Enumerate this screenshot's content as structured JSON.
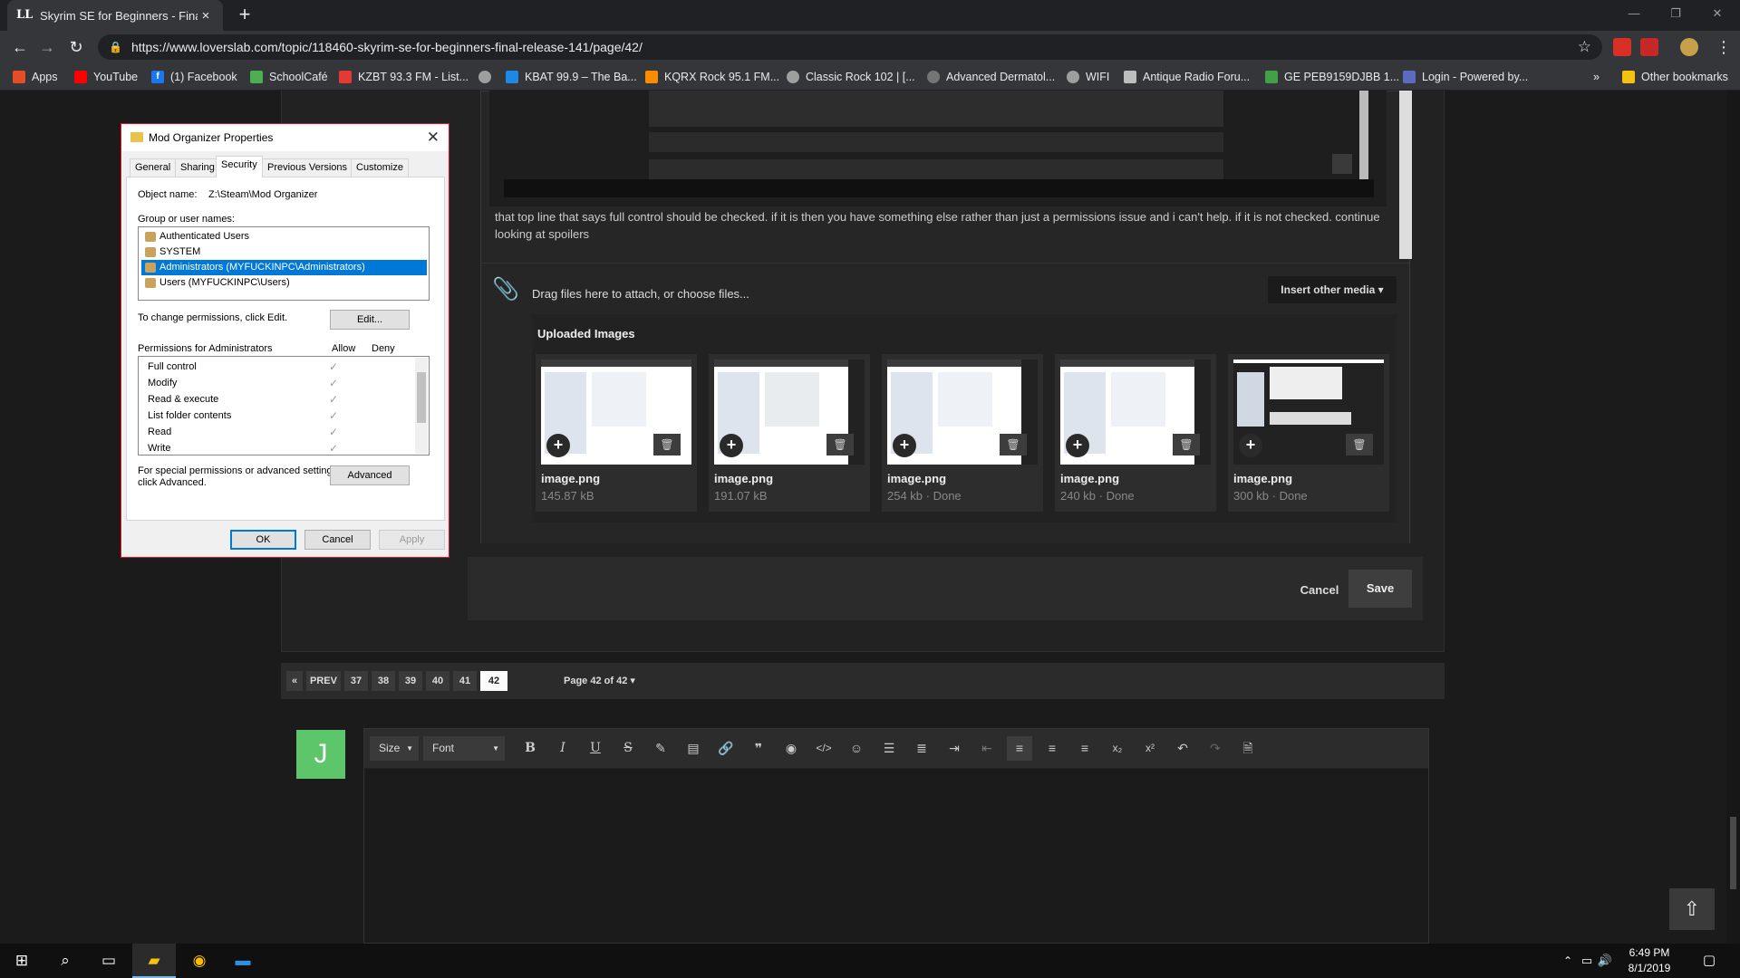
{
  "browser": {
    "tab_title": "Skyrim SE for Beginners - Final R",
    "tab_icon": "LL",
    "url": "https://www.loverslab.com/topic/118460-skyrim-se-for-beginners-final-release-141/page/42/",
    "bookmarks": [
      {
        "label": "Apps",
        "icon": "apps-grid-icon",
        "color": "#e44d26"
      },
      {
        "label": "YouTube",
        "icon": "youtube-icon",
        "color": "#ff0000"
      },
      {
        "label": "(1) Facebook",
        "icon": "facebook-icon",
        "color": "#1877f2"
      },
      {
        "label": "SchoolCafé",
        "icon": "schoolcafe-icon",
        "color": "#4caf50"
      },
      {
        "label": "KZBT 93.3 FM - List...",
        "icon": "radio-icon",
        "color": "#e53935"
      },
      {
        "label": "",
        "icon": "globe-icon",
        "color": "#9e9e9e"
      },
      {
        "label": "KBAT 99.9 – The Ba...",
        "icon": "kbat-icon",
        "color": "#1e88e5"
      },
      {
        "label": "KQRX Rock 95.1 FM...",
        "icon": "radio-icon",
        "color": "#fb8c00"
      },
      {
        "label": "Classic Rock 102 | [...",
        "icon": "globe-icon",
        "color": "#9e9e9e"
      },
      {
        "label": "Advanced Dermatol...",
        "icon": "globe-icon",
        "color": "#757575"
      },
      {
        "label": "WIFI",
        "icon": "globe-icon",
        "color": "#9e9e9e"
      },
      {
        "label": "Antique Radio Foru...",
        "icon": "radio-icon",
        "color": "#bdbdbd"
      },
      {
        "label": "GE PEB9159DJBB 1...",
        "icon": "appliance-icon",
        "color": "#43a047"
      },
      {
        "label": "Login - Powered by...",
        "icon": "login-icon",
        "color": "#5c6bc0"
      }
    ],
    "more_bookmarks": "»",
    "other_bookmarks": "Other bookmarks"
  },
  "post": {
    "text": "that top line that says full control should be checked. if it is then you have something else rather than just a permissions issue and i can't help. if it is not checked. continue looking at spoilers"
  },
  "attachments": {
    "drag_text": "Drag files here to attach, or choose files...",
    "insert_media": "Insert other media ▾",
    "uploaded_title": "Uploaded Images",
    "images": [
      {
        "name": "image.png",
        "size": "145.87 kB"
      },
      {
        "name": "image.png",
        "size": "191.07 kB"
      },
      {
        "name": "image.png",
        "size": "254 kb · Done"
      },
      {
        "name": "image.png",
        "size": "240 kb · Done"
      },
      {
        "name": "image.png",
        "size": "300 kb · Done"
      }
    ]
  },
  "actions": {
    "cancel": "Cancel",
    "save": "Save"
  },
  "pagination": {
    "first": "«",
    "prev": "PREV",
    "pages": [
      "37",
      "38",
      "39",
      "40",
      "41",
      "42"
    ],
    "current": "42",
    "page_label": "Page 42 of 42 ▾"
  },
  "composer": {
    "avatar_letter": "J",
    "size_label": "Size",
    "font_label": "Font"
  },
  "dialog": {
    "title": "Mod Organizer Properties",
    "tabs": [
      "General",
      "Sharing",
      "Security",
      "Previous Versions",
      "Customize"
    ],
    "active_tab": "Security",
    "object_name_label": "Object name:",
    "object_name_value": "Z:\\Steam\\Mod Organizer",
    "group_label": "Group or user names:",
    "users": [
      "Authenticated Users",
      "SYSTEM",
      "Administrators (MYFUCKINPC\\Administrators)",
      "Users (MYFUCKINPC\\Users)"
    ],
    "selected_user": "Administrators (MYFUCKINPC\\Administrators)",
    "change_text": "To change permissions, click Edit.",
    "edit_btn": "Edit...",
    "perm_label": "Permissions for Administrators",
    "allow_label": "Allow",
    "deny_label": "Deny",
    "permissions": [
      {
        "name": "Full control",
        "allow": "✓"
      },
      {
        "name": "Modify",
        "allow": "✓"
      },
      {
        "name": "Read & execute",
        "allow": "✓"
      },
      {
        "name": "List folder contents",
        "allow": "✓"
      },
      {
        "name": "Read",
        "allow": "✓"
      },
      {
        "name": "Write",
        "allow": "✓"
      }
    ],
    "special_text_1": "For special permissions or advanced settings,",
    "special_text_2": "click Advanced.",
    "advanced_btn": "Advanced",
    "ok_btn": "OK",
    "cancel_btn": "Cancel",
    "apply_btn": "Apply"
  },
  "taskbar": {
    "time": "6:49 PM",
    "date": "8/1/2019"
  }
}
